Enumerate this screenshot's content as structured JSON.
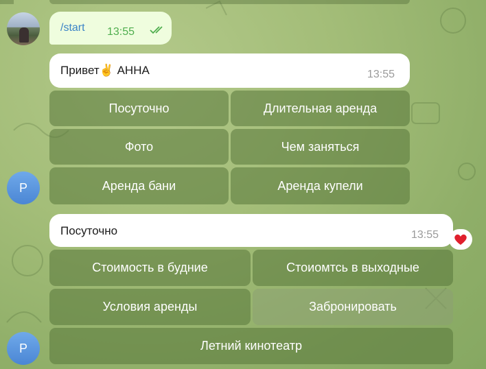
{
  "user_message": {
    "text": "/start",
    "time": "13:55"
  },
  "bot_message_1": {
    "text": "Привет✌️ АННА",
    "time": "13:55",
    "keyboard": [
      [
        "Посуточно",
        "Длительная аренда"
      ],
      [
        "Фото",
        "Чем заняться"
      ],
      [
        "Аренда бани",
        "Аренда купели"
      ]
    ]
  },
  "bot_message_2": {
    "text": "Посуточно",
    "time": "13:55",
    "reaction": "❤️",
    "keyboard": [
      [
        "Стоимость в будние",
        "Стоиомтсь в выходные"
      ],
      [
        "Условия аренды",
        "Забронировать"
      ],
      [
        "Летний кинотеатр"
      ]
    ]
  },
  "bot_avatar_letter": "P",
  "colors": {
    "background": "#a3bd78",
    "outgoing_bubble": "#effdde",
    "button_bg": "#58763a",
    "link": "#3a83c7",
    "read_checks": "#4fae4e"
  }
}
